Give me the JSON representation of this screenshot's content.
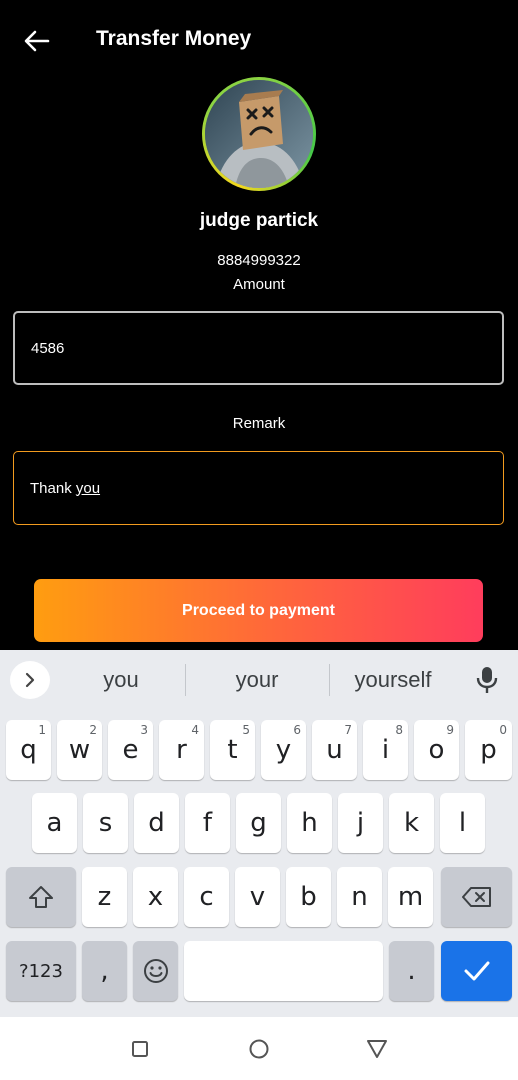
{
  "header": {
    "title": "Transfer Money",
    "back_icon": "arrow-left-icon"
  },
  "recipient": {
    "name": "judge partick",
    "phone": "8884999322"
  },
  "amount": {
    "label": "Amount",
    "value": "4586"
  },
  "remark": {
    "label": "Remark",
    "value_plain": "Thank ",
    "value_underlined": "you"
  },
  "proceed": {
    "label": "Proceed to payment",
    "gradient_start": "#ff9d10",
    "gradient_end": "#ff3d5c"
  },
  "keyboard": {
    "suggestions": [
      "you",
      "your",
      "yourself"
    ],
    "row1": [
      {
        "key": "q",
        "hint": "1"
      },
      {
        "key": "w",
        "hint": "2"
      },
      {
        "key": "e",
        "hint": "3"
      },
      {
        "key": "r",
        "hint": "4"
      },
      {
        "key": "t",
        "hint": "5"
      },
      {
        "key": "y",
        "hint": "6"
      },
      {
        "key": "u",
        "hint": "7"
      },
      {
        "key": "i",
        "hint": "8"
      },
      {
        "key": "o",
        "hint": "9"
      },
      {
        "key": "p",
        "hint": "0"
      }
    ],
    "row2": [
      "a",
      "s",
      "d",
      "f",
      "g",
      "h",
      "j",
      "k",
      "l"
    ],
    "row3": [
      "z",
      "x",
      "c",
      "v",
      "b",
      "n",
      "m"
    ],
    "symbols_key": "?123",
    "comma_key": ",",
    "period_key": ".",
    "enter_color": "#1a73e8"
  },
  "navigation": {
    "icons": [
      "square-recents-icon",
      "circle-home-icon",
      "triangle-back-icon"
    ]
  }
}
